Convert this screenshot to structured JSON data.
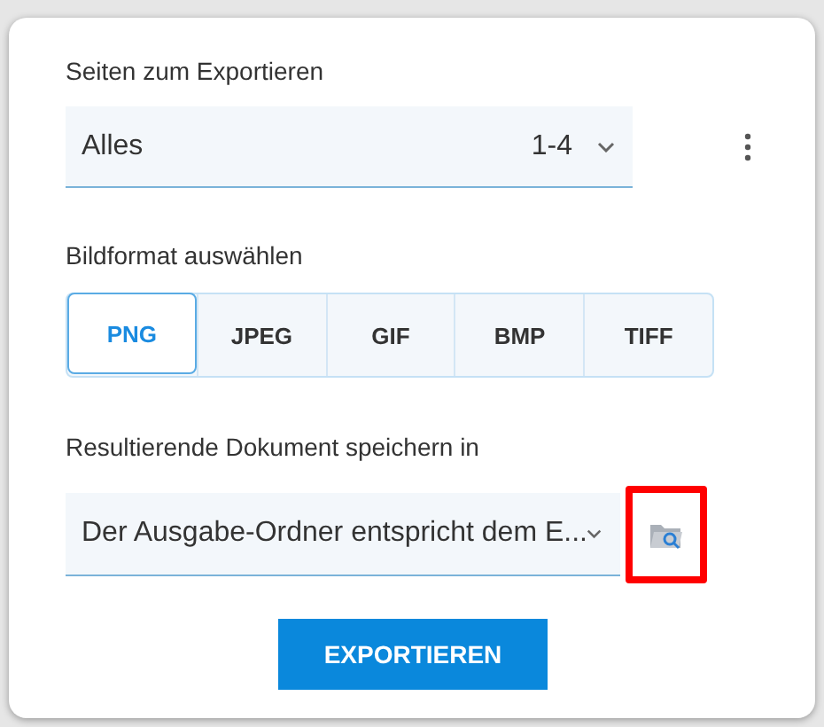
{
  "pages": {
    "label": "Seiten zum Exportieren",
    "value": "Alles",
    "range": "1-4"
  },
  "format": {
    "label": "Bildformat auswählen",
    "options": [
      {
        "label": "PNG",
        "selected": true
      },
      {
        "label": "JPEG",
        "selected": false
      },
      {
        "label": "GIF",
        "selected": false
      },
      {
        "label": "BMP",
        "selected": false
      },
      {
        "label": "TIFF",
        "selected": false
      }
    ]
  },
  "destination": {
    "label": "Resultierende Dokument speichern in",
    "value": "Der Ausgabe-Ordner entspricht dem E...",
    "browse_highlighted": true
  },
  "export_button": "EXPORTIEREN"
}
